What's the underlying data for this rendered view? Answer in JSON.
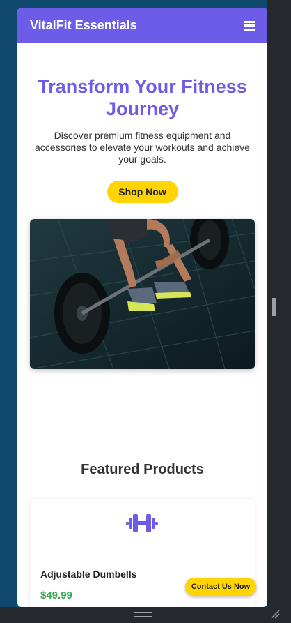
{
  "navbar": {
    "brand": "VitalFit Essentials",
    "menu_icon": "hamburger-menu-icon"
  },
  "hero": {
    "title": "Transform Your Fitness Journey",
    "text": "Discover premium fitness equipment and accessories to elevate your workouts and achieve your goals.",
    "cta": "Shop Now"
  },
  "featured": {
    "title": "Featured Products",
    "products": [
      {
        "icon": "dumbbell-icon",
        "name": "Adjustable Dumbells",
        "price": "$49.99",
        "rating": "★★★★★"
      }
    ]
  },
  "contact": {
    "label": "Contact Us Now"
  },
  "colors": {
    "primary": "#6c5ce7",
    "accent": "#ffd400",
    "price": "#3aa655"
  }
}
